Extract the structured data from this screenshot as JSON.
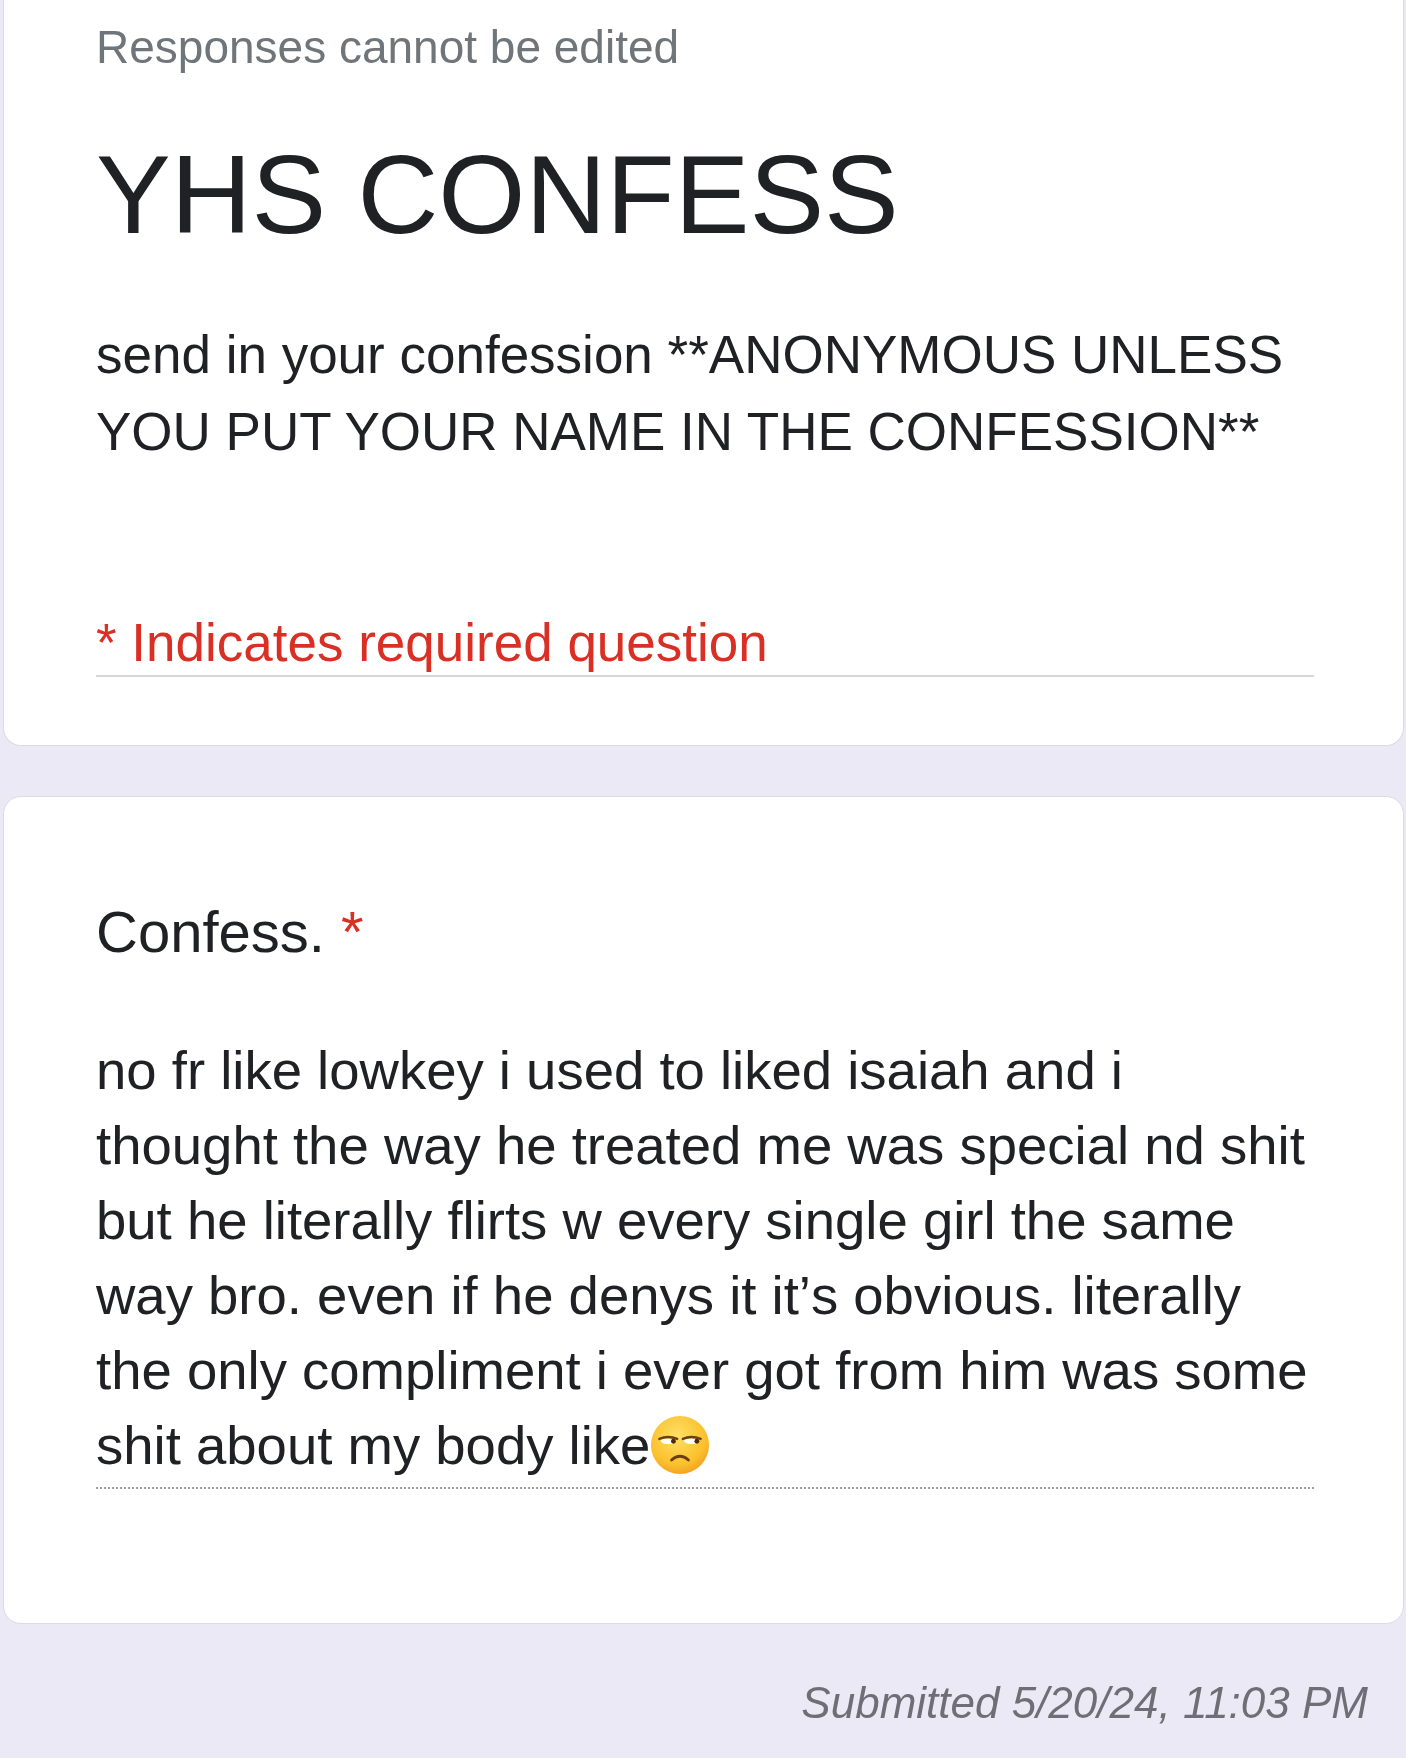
{
  "notice": "Responses cannot be edited",
  "form": {
    "title": "YHS CONFESS",
    "description": "send in your confession **ANONYMOUS UNLESS YOU PUT YOUR NAME IN THE CONFESSION**",
    "required_note": "* Indicates required question"
  },
  "questions": [
    {
      "title": "Confess.",
      "required_marker": "*",
      "answer": "no fr like lowkey i used to liked isaiah and i thought the way he treated me was special nd shit but he literally flirts w every single girl the same way bro. even if he denys it it’s obvious. literally the only compliment i ever got from him was some shit about my body like"
    }
  ],
  "footer": {
    "submitted": "Submitted 5/20/24, 11:03 PM"
  }
}
